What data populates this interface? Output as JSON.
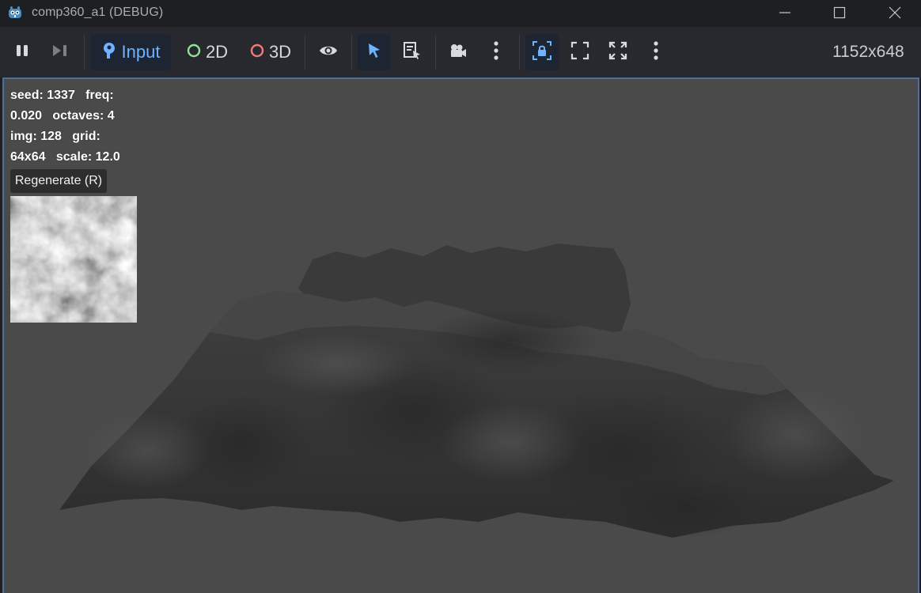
{
  "window": {
    "title": "comp360_a1 (DEBUG)"
  },
  "toolbar": {
    "input_label": "Input",
    "mode_2d_label": "2D",
    "mode_3d_label": "3D",
    "resolution": "1152x648"
  },
  "overlay": {
    "line1": "seed: 1337   freq:",
    "line2": "0.020   octaves: 4",
    "line3": "img: 128   grid:",
    "line4": "64x64   scale: 12.0",
    "regenerate_label": "Regenerate (R)"
  },
  "colors": {
    "accent_blue": "#6fb2ff",
    "mode_2d_ring": "#8fe29b",
    "mode_3d_ring": "#f07b7b",
    "viewport_bg": "#4a4a4a",
    "viewport_border": "#4f6f96"
  },
  "icons": {
    "app": "godot-logo-icon",
    "pause": "pause-icon",
    "step": "step-forward-icon",
    "input": "input-pointer-icon",
    "visibility": "eye-icon",
    "select": "cursor-arrow-icon",
    "list_select": "list-select-icon",
    "camera": "camera-icon",
    "more": "kebab-menu-icon",
    "lock": "camera-lock-icon",
    "fullscreen": "fullscreen-icon",
    "fit": "fit-view-icon"
  }
}
